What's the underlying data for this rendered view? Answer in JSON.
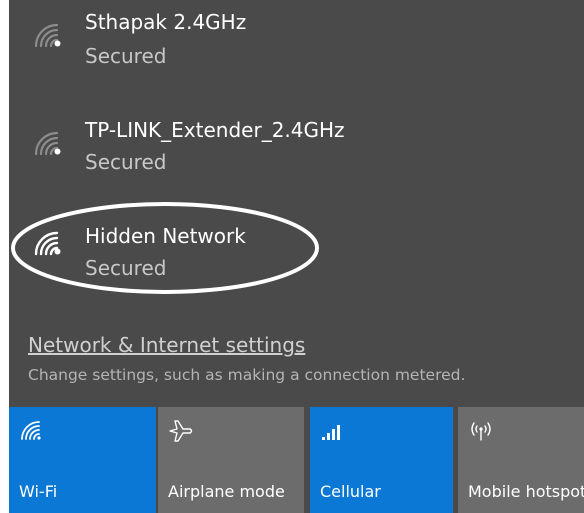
{
  "networks": [
    {
      "name": "Sthapak 2.4GHz",
      "status": "Secured",
      "icon": "wifi-secured-icon"
    },
    {
      "name": "TP-LINK_Extender_2.4GHz",
      "status": "Secured",
      "icon": "wifi-secured-icon"
    },
    {
      "name": "Hidden Network",
      "status": "Secured",
      "icon": "wifi-secured-icon"
    }
  ],
  "settings": {
    "link_label": "Network & Internet settings",
    "description": "Change settings, such as making a connection metered."
  },
  "quick_actions": [
    {
      "label": "Wi-Fi",
      "icon": "wifi-icon",
      "active": true
    },
    {
      "label": "Airplane mode",
      "icon": "airplane-icon",
      "active": false
    },
    {
      "label": "Cellular",
      "icon": "cellular-signal-icon",
      "active": true
    },
    {
      "label": "Mobile hotspot",
      "icon": "mobile-hotspot-icon",
      "active": false
    }
  ],
  "colors": {
    "panel_background": "#4a4a4a",
    "tile_active": "#0a78d4",
    "tile_inactive": "#6c6c6c",
    "highlight_annotation": "#ffffff"
  }
}
